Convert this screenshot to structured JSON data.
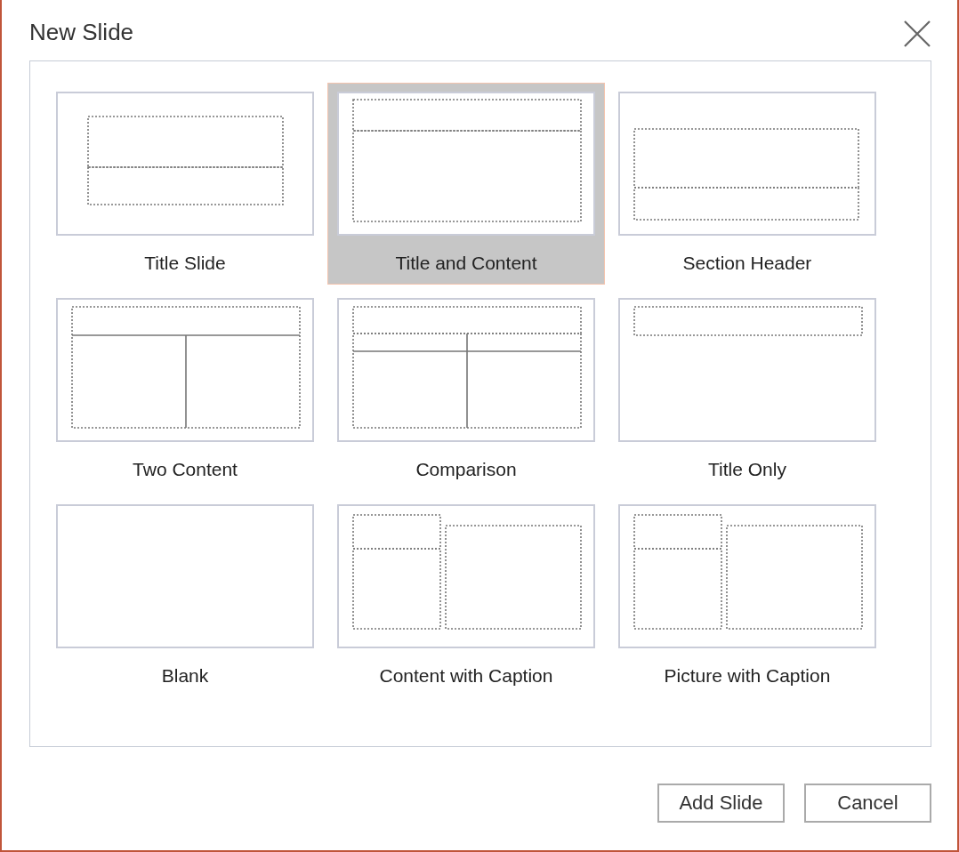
{
  "window": {
    "title": "New Slide"
  },
  "layouts": [
    {
      "label": "Title Slide",
      "kind": "title-slide",
      "selected": false
    },
    {
      "label": "Title and Content",
      "kind": "title-content",
      "selected": true
    },
    {
      "label": "Section Header",
      "kind": "section-header",
      "selected": false
    },
    {
      "label": "Two Content",
      "kind": "two-content",
      "selected": false
    },
    {
      "label": "Comparison",
      "kind": "comparison",
      "selected": false
    },
    {
      "label": "Title Only",
      "kind": "title-only",
      "selected": false
    },
    {
      "label": "Blank",
      "kind": "blank",
      "selected": false
    },
    {
      "label": "Content with Caption",
      "kind": "content-caption",
      "selected": false
    },
    {
      "label": "Picture with Caption",
      "kind": "picture-caption",
      "selected": false
    }
  ],
  "buttons": [
    "Add Slide",
    "Cancel"
  ]
}
